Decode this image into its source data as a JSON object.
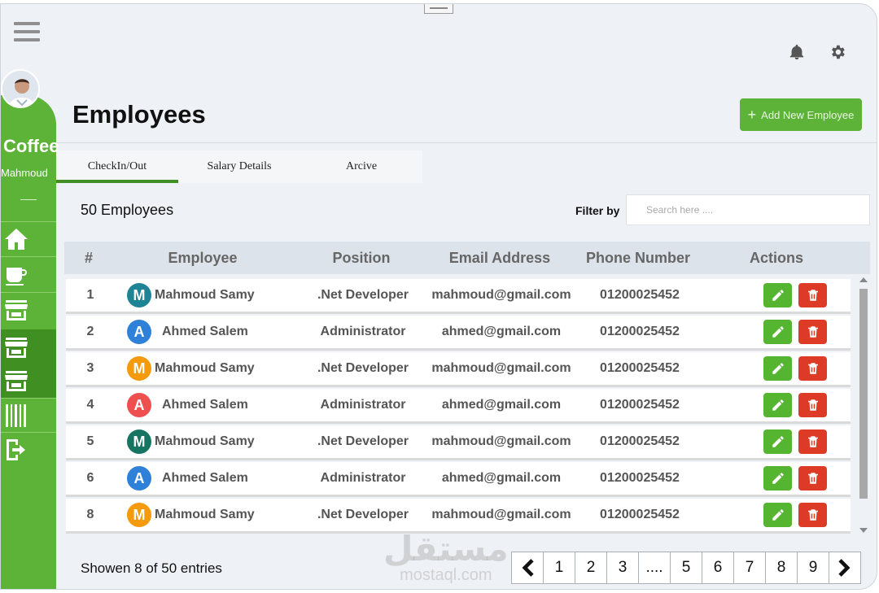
{
  "sidebar": {
    "brand": "Coffee",
    "user": "Mahmoud",
    "separator": "—",
    "items": [
      {
        "icon": "home-icon"
      },
      {
        "icon": "coffee-cup-icon"
      },
      {
        "icon": "store-icon"
      },
      {
        "icon": "store-icon",
        "active": true
      },
      {
        "icon": "store-icon",
        "active": true
      },
      {
        "icon": "barcode-icon"
      },
      {
        "icon": "logout-icon"
      }
    ]
  },
  "header": {
    "title": "Employees",
    "add_label": "Add New Employee",
    "add_plus": "+"
  },
  "tabs": [
    {
      "label": "CheckIn/Out",
      "active": true
    },
    {
      "label": "Salary Details"
    },
    {
      "label": "Arcive"
    }
  ],
  "toolbar": {
    "count": "50 Employees",
    "filter_label": "Filter by",
    "search_placeholder": "Search here ...."
  },
  "table": {
    "columns": [
      "#",
      "Employee",
      "Position",
      "Email Address",
      "Phone Number",
      "Actions"
    ],
    "rows": [
      {
        "num": "1",
        "letter": "M",
        "color": "#1d8496",
        "name": "Mahmoud Samy",
        "position": ".Net Developer",
        "email": "mahmoud@gmail.com",
        "phone": "01200025452"
      },
      {
        "num": "2",
        "letter": "A",
        "color": "#2f80d8",
        "name": "Ahmed Salem",
        "position": "Administrator",
        "email": "ahmed@gmail.com",
        "phone": "01200025452"
      },
      {
        "num": "3",
        "letter": "M",
        "color": "#f59a0c",
        "name": "Mahmoud Samy",
        "position": ".Net Developer",
        "email": "mahmoud@gmail.com",
        "phone": "01200025452"
      },
      {
        "num": "4",
        "letter": "A",
        "color": "#ee4f4f",
        "name": "Ahmed Salem",
        "position": "Administrator",
        "email": "ahmed@gmail.com",
        "phone": "01200025452"
      },
      {
        "num": "5",
        "letter": "M",
        "color": "#167463",
        "name": "Mahmoud Samy",
        "position": ".Net Developer",
        "email": "mahmoud@gmail.com",
        "phone": "01200025452"
      },
      {
        "num": "6",
        "letter": "A",
        "color": "#2f80d8",
        "name": "Ahmed Salem",
        "position": "Administrator",
        "email": "ahmed@gmail.com",
        "phone": "01200025452"
      },
      {
        "num": "8",
        "letter": "M",
        "color": "#f59a0c",
        "name": "Mahmoud Samy",
        "position": ".Net Developer",
        "email": "mahmoud@gmail.com",
        "phone": "01200025452"
      }
    ]
  },
  "footer": {
    "shown": "Showen 8 of 50 entries",
    "pages": [
      "1",
      "2",
      "3",
      "....",
      "5",
      "6",
      "7",
      "8",
      "9"
    ]
  },
  "watermark": {
    "arabic": "مستقل",
    "latin": "mostaql.com"
  },
  "colors": {
    "accent": "#5cb338",
    "accent_dark": "#3f8f22",
    "edit": "#55b531",
    "delete": "#dd3b26"
  }
}
